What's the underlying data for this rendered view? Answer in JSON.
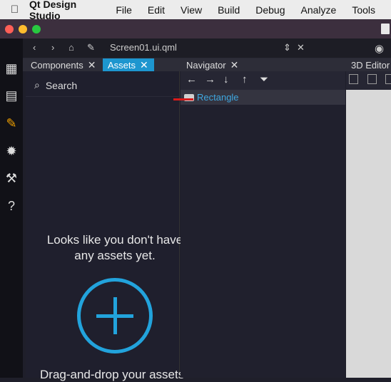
{
  "menubar": {
    "app_name": "Qt Design Studio",
    "items": [
      "File",
      "Edit",
      "View",
      "Build",
      "Debug",
      "Analyze",
      "Tools"
    ]
  },
  "toolbar": {
    "document_name": "Screen01.ui.qml"
  },
  "tabs": {
    "components": "Components",
    "assets": "Assets",
    "navigator": "Navigator",
    "editor3d": "3D Editor"
  },
  "assets": {
    "search_label": "Search",
    "empty_message": "Looks like you don't have\nany assets yet.",
    "drag_hint": "Drag-and-drop your assets"
  },
  "navigator": {
    "items": [
      "Rectangle"
    ]
  },
  "colors": {
    "accent": "#1d96cf",
    "link": "#3fa7df",
    "active_tool": "#f0a000",
    "drag_marker": "#d81a1a"
  }
}
